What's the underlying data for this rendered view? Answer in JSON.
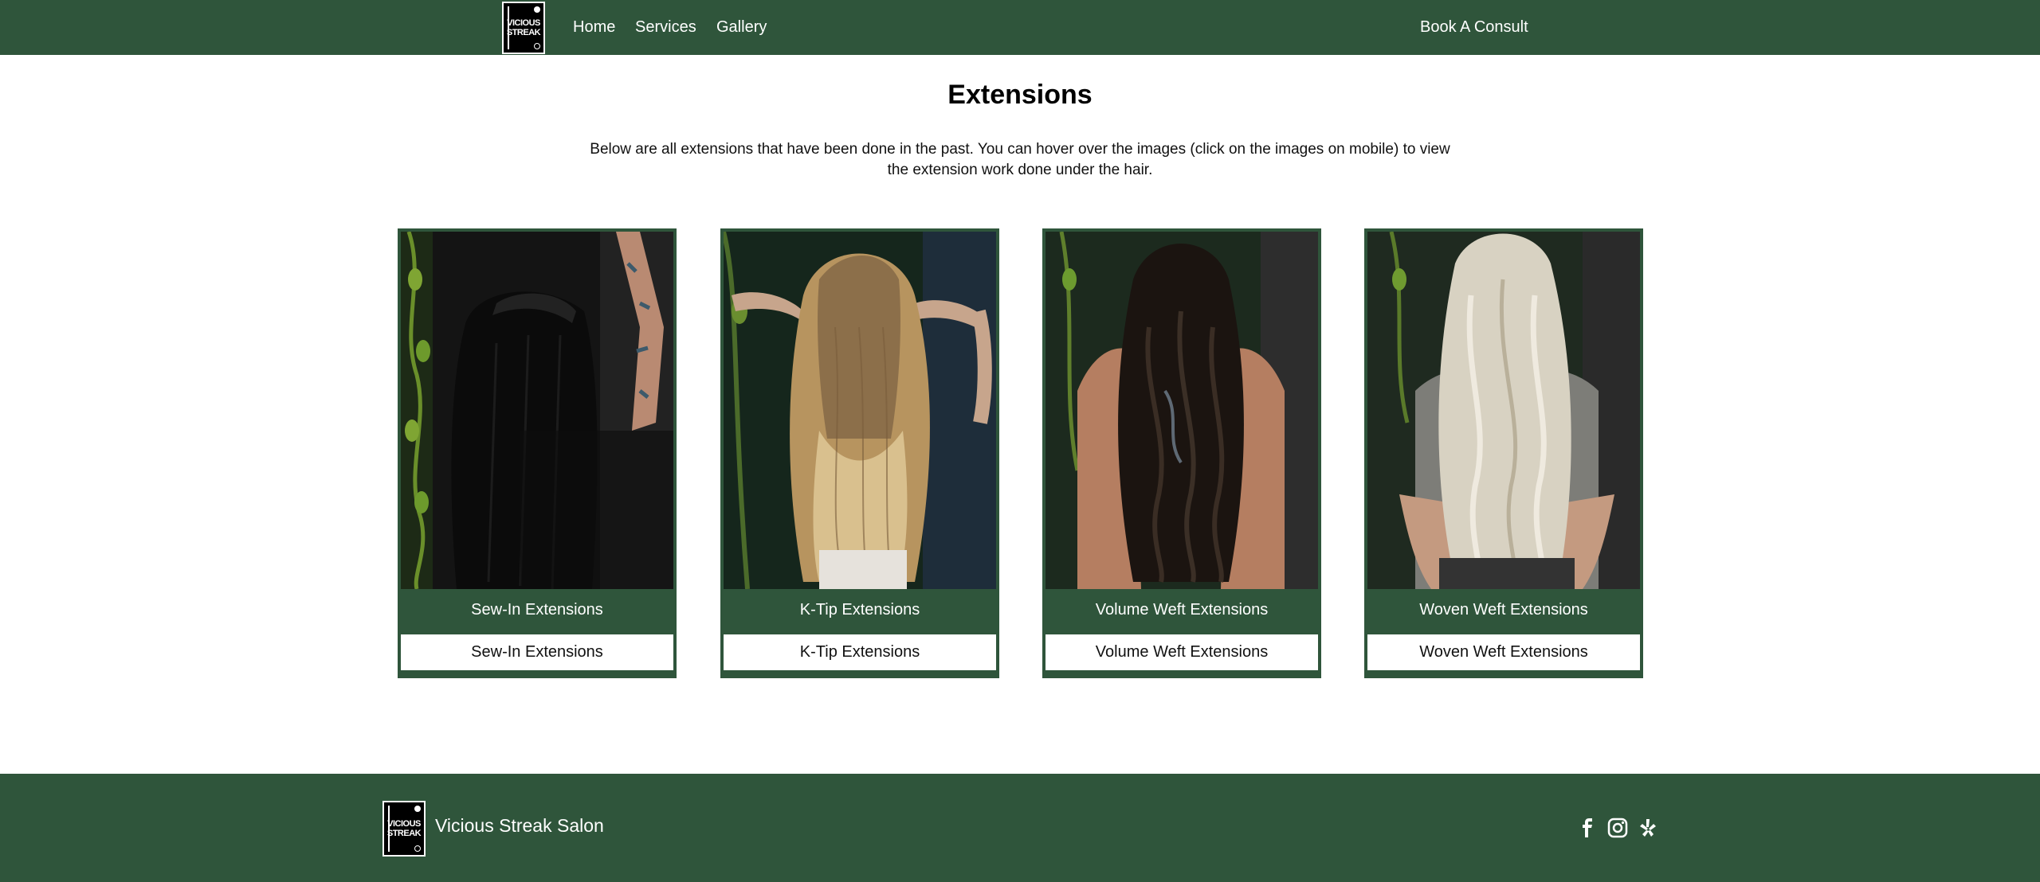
{
  "nav": {
    "logo_text_line1": "VICIOUS",
    "logo_text_line2": "STREAK",
    "links": [
      "Home",
      "Services",
      "Gallery"
    ],
    "cta": "Book A Consult"
  },
  "page": {
    "title": "Extensions",
    "intro": "Below are all extensions that have been done in the past. You can hover over the images (click on the images on mobile) to view the extension work done under the hair."
  },
  "cards": [
    {
      "title": "Sew-In Extensions",
      "label": "Sew-In Extensions"
    },
    {
      "title": "K-Tip Extensions",
      "label": "K-Tip Extensions"
    },
    {
      "title": "Volume Weft Extensions",
      "label": "Volume Weft Extensions"
    },
    {
      "title": "Woven Weft Extensions",
      "label": "Woven Weft Extensions"
    }
  ],
  "footer": {
    "salon_name": "Vicious Streak Salon",
    "social_icons": [
      "facebook-icon",
      "instagram-icon",
      "yelp-icon"
    ]
  },
  "colors": {
    "brand_green": "#2f553b",
    "background": "#ffffff"
  }
}
